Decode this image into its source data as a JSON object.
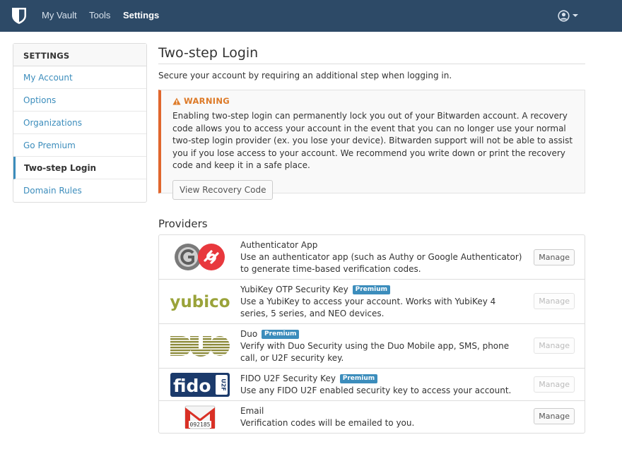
{
  "navbar": {
    "brand_icon": "shield-icon",
    "items": [
      {
        "label": "My Vault",
        "active": false
      },
      {
        "label": "Tools",
        "active": false
      },
      {
        "label": "Settings",
        "active": true
      }
    ],
    "user_icon": "user-circle-icon"
  },
  "sidebar": {
    "title": "SETTINGS",
    "items": [
      {
        "label": "My Account",
        "active": false
      },
      {
        "label": "Options",
        "active": false
      },
      {
        "label": "Organizations",
        "active": false
      },
      {
        "label": "Go Premium",
        "active": false
      },
      {
        "label": "Two-step Login",
        "active": true
      },
      {
        "label": "Domain Rules",
        "active": false
      }
    ]
  },
  "main": {
    "title": "Two-step Login",
    "subtitle": "Secure your account by requiring an additional step when logging in.",
    "warning": {
      "title": "WARNING",
      "icon": "warning-triangle-icon",
      "body": "Enabling two-step login can permanently lock you out of your Bitwarden account. A recovery code allows you to access your account in the event that you can no longer use your normal two-step login provider (ex. you lose your device). Bitwarden support will not be able to assist you if you lose access to your account. We recommend you write down or print the recovery code and keep it in a safe place.",
      "button_label": "View Recovery Code"
    },
    "providers_title": "Providers",
    "providers": [
      {
        "name": "Authenticator App",
        "premium": false,
        "desc": "Use an authenticator app (such as Authy or Google Authenticator) to generate time-based verification codes.",
        "manage": "Manage",
        "enabled": true,
        "logo": "authenticator-logo"
      },
      {
        "name": "YubiKey OTP Security Key",
        "premium": true,
        "desc": "Use a YubiKey to access your account. Works with YubiKey 4 series, 5 series, and NEO devices.",
        "manage": "Manage",
        "enabled": false,
        "logo": "yubico-logo"
      },
      {
        "name": "Duo",
        "premium": true,
        "desc": "Verify with Duo Security using the Duo Mobile app, SMS, phone call, or U2F security key.",
        "manage": "Manage",
        "enabled": false,
        "logo": "duo-logo"
      },
      {
        "name": "FIDO U2F Security Key",
        "premium": true,
        "desc": "Use any FIDO U2F enabled security key to access your account.",
        "manage": "Manage",
        "enabled": false,
        "logo": "fido-logo"
      },
      {
        "name": "Email",
        "premium": false,
        "desc": "Verification codes will be emailed to you.",
        "manage": "Manage",
        "enabled": true,
        "logo": "gmail-logo",
        "logo_text": "092185"
      }
    ],
    "premium_badge": "Premium"
  }
}
